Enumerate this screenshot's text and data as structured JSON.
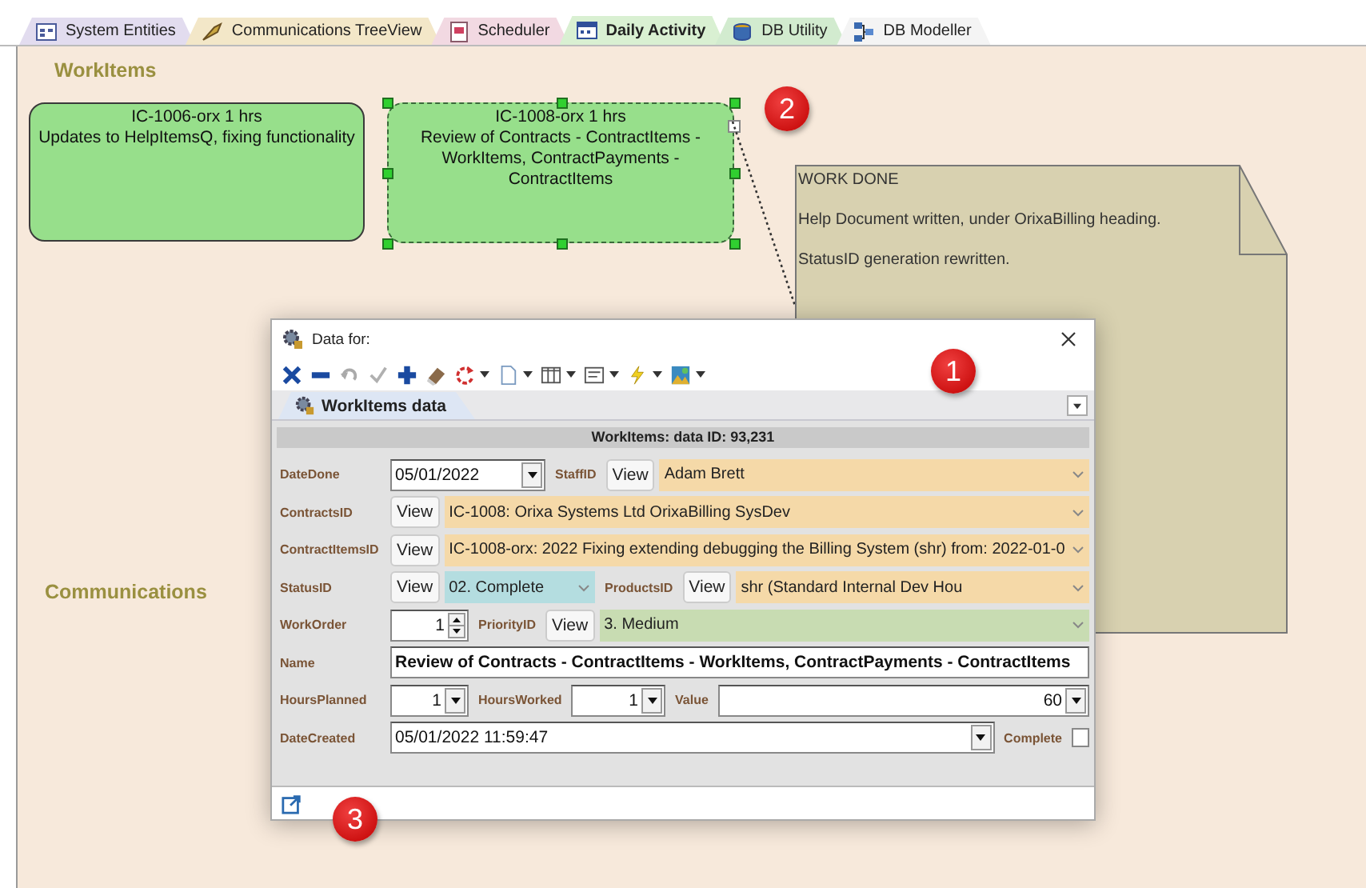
{
  "tabs": [
    {
      "label": "System Entities",
      "color": "#e2dcef",
      "selected": false
    },
    {
      "label": "Communications TreeView",
      "color": "#f3e7c8",
      "selected": false
    },
    {
      "label": "Scheduler",
      "color": "#f2d9e2",
      "selected": false
    },
    {
      "label": "Daily Activity",
      "color": "#d9f0d2",
      "selected": true
    },
    {
      "label": "DB Utility",
      "color": "#d2ebcf",
      "selected": false
    },
    {
      "label": "DB Modeller",
      "color": "#f4f4f4",
      "selected": false
    }
  ],
  "canvas": {
    "sections": [
      {
        "label": "WorkItems"
      },
      {
        "label": "Communications"
      }
    ],
    "nodes": [
      {
        "title": "IC-1006-orx 1 hrs",
        "text": "Updates to HelpItemsQ, fixing functionality",
        "selected": false
      },
      {
        "title": "IC-1008-orx 1 hrs",
        "text": "Review of Contracts - ContractItems - WorkItems, ContractPayments - ContractItems",
        "selected": true
      }
    ],
    "note": {
      "lines": [
        "WORK DONE",
        "Help Document written, under OrixaBilling heading.",
        "StatusID generation rewritten."
      ]
    },
    "callouts": [
      "1",
      "2",
      "3"
    ]
  },
  "dialog": {
    "title": "Data for:",
    "tab": {
      "label": "WorkItems data",
      "selected": true
    },
    "header": "WorkItems: data ID: 93,231",
    "form_lines": [
      {
        "fields": [
          {
            "kind": "date",
            "label": "DateDone",
            "value": "05/01/2022"
          },
          {
            "kind": "lookup",
            "label": "StaffID",
            "button": "View",
            "value": "Adam Brett",
            "color": "#f5d9a8"
          }
        ]
      },
      {
        "fields": [
          {
            "kind": "lookup",
            "label": "ContractsID",
            "button": "View",
            "value": "IC-1008: Orixa Systems Ltd OrixaBilling SysDev",
            "color": "#f5d9a8"
          }
        ]
      },
      {
        "fields": [
          {
            "kind": "lookup",
            "label": "ContractItemsID",
            "button": "View",
            "value": "IC-1008-orx: 2022 Fixing extending debugging the Billing System (shr) from: 2022-01-0",
            "color": "#f5d9a8"
          }
        ]
      },
      {
        "fields": [
          {
            "kind": "lookup",
            "label": "StatusID",
            "button": "View",
            "value": "02. Complete",
            "color": "#b4dde0"
          },
          {
            "kind": "lookup",
            "label": "ProductsID",
            "button": "View",
            "value": "shr (Standard Internal Dev Hou",
            "color": "#f5d9a8"
          }
        ]
      },
      {
        "fields": [
          {
            "kind": "spin",
            "label": "WorkOrder",
            "value": "1"
          },
          {
            "kind": "lookup",
            "label": "PriorityID",
            "button": "View",
            "value": "3. Medium",
            "color": "#c8dcb2"
          }
        ]
      },
      {
        "fields": [
          {
            "kind": "text",
            "label": "Name",
            "value": "Review of Contracts - ContractItems - WorkItems, ContractPayments - ContractItems"
          }
        ]
      },
      {
        "fields": [
          {
            "kind": "number",
            "label": "HoursPlanned",
            "value": "1"
          },
          {
            "kind": "number",
            "label": "HoursWorked",
            "value": "1"
          },
          {
            "kind": "number",
            "label": "Value",
            "value": "60"
          }
        ]
      },
      {
        "fields": [
          {
            "kind": "date",
            "label": "DateCreated",
            "value": "05/01/2022 11:59:47"
          },
          {
            "kind": "checkbox",
            "label": "Complete",
            "checked": false
          }
        ]
      }
    ]
  }
}
